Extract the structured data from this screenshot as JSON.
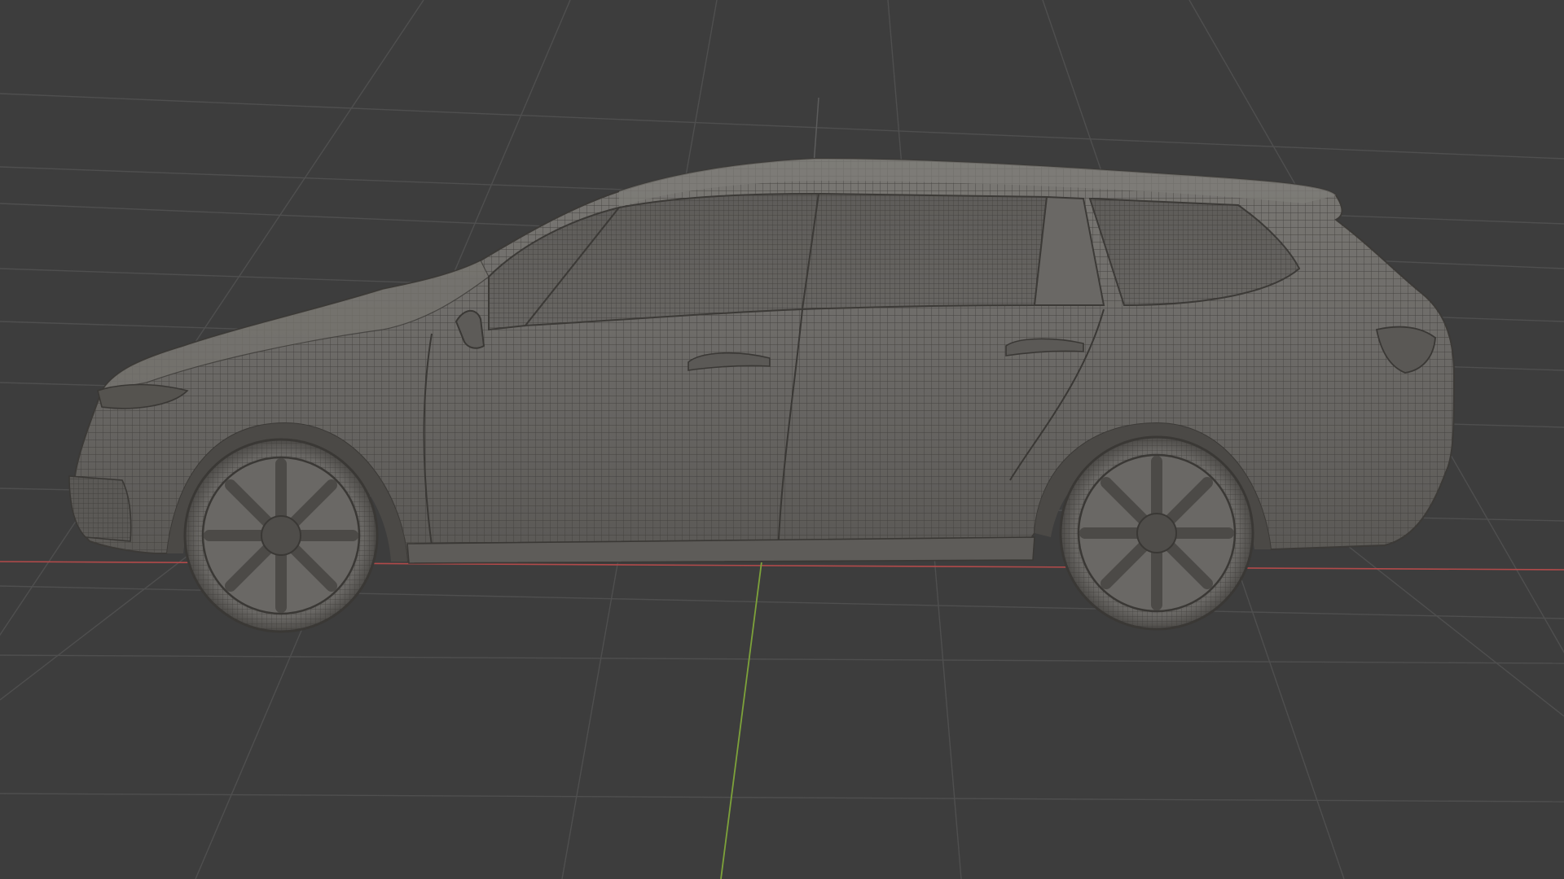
{
  "viewport": {
    "background_color": "#3d3d3d",
    "grid_color": "#4f4f4f",
    "x_axis_color": "#b24a4a",
    "y_axis_color": "#7da23a",
    "z_axis_color": "#5a5a5a",
    "mesh_fill_color": "#6d6b68",
    "mesh_dark_color": "#4a4845",
    "mesh_wire_color": "#3f3d3a",
    "mesh_highlight_color": "#807e7a",
    "shading_mode": "wireframe-overlay",
    "object": "car-mesh"
  }
}
